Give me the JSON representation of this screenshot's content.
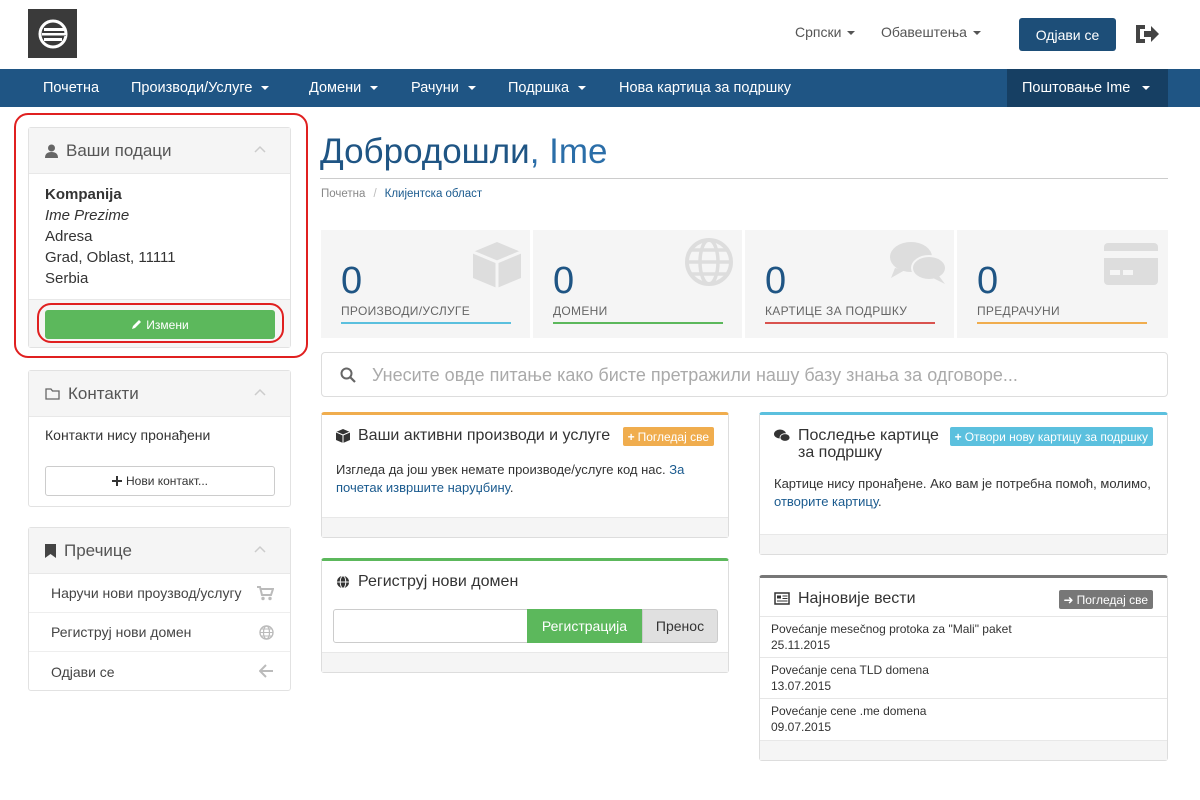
{
  "header": {
    "language": "Српски",
    "notifications": "Обавештења",
    "logout": "Одјави се"
  },
  "nav": {
    "items": [
      {
        "label": "Почетна"
      },
      {
        "label": "Производи/Услуге"
      },
      {
        "label": "Домени"
      },
      {
        "label": "Рачуни"
      },
      {
        "label": "Подршка"
      },
      {
        "label": "Нова картица за подршку"
      }
    ],
    "account": "Поштовање Ime"
  },
  "sidebar": {
    "your_info": {
      "title": "Ваши подаци",
      "company": "Kompanija",
      "name": "Ime Prezime",
      "address": "Adresa",
      "city": "Grad, Oblast, 11111",
      "country": "Serbia",
      "edit_button": "Измени"
    },
    "contacts": {
      "title": "Контакти",
      "empty": "Контакти нису пронађени",
      "new_button": "Нови контакт..."
    },
    "shortcuts": {
      "title": "Пречице",
      "items": [
        {
          "label": "Наручи нови проузвод/услугу",
          "icon": "cart-icon"
        },
        {
          "label": "Регистpуј нови домен",
          "icon": "globe-icon"
        },
        {
          "label": "Одјави се",
          "icon": "arrow-left-icon"
        }
      ]
    }
  },
  "main": {
    "welcome": "Добродошли",
    "welcome_name": ", Ime",
    "breadcrumb": [
      "Почетна",
      "Клијентска област"
    ],
    "tiles": [
      {
        "value": "0",
        "label": "ПРОИЗВОДИ/УСЛУГЕ",
        "color": "#5bc0de",
        "icon": "cube-icon"
      },
      {
        "value": "0",
        "label": "ДОМЕНИ",
        "color": "#5cb85c",
        "icon": "globe-icon"
      },
      {
        "value": "0",
        "label": "КАРТИЦЕ ЗА ПОДРШКУ",
        "color": "#d9534f",
        "icon": "comments-icon"
      },
      {
        "value": "0",
        "label": "ПРЕДРАЧУНИ",
        "color": "#f0ad4e",
        "icon": "credit-card-icon"
      }
    ],
    "search_placeholder": "Унесите овде питање како бисте претражили нашу базу знања за одговоре...",
    "active_products": {
      "title": "Ваши активни производи и услуге",
      "button": "Погледај све",
      "text_before": "Изгледа да још увек немате производе/услуге код нас.",
      "link": "За почетак извршите наруџбину",
      "text_after": "."
    },
    "register_domain": {
      "title": "Региструј нови домен",
      "register_button": "Регистрација",
      "transfer_button": "Пренос"
    },
    "recent_tickets": {
      "title": "Последње картице за подршку",
      "button": "Отвори нову картицу за подршку",
      "text_before": "Картице нису пронађене. Ако вам је потребна помоћ, молимо,",
      "link": "отворите картицу",
      "text_after": "."
    },
    "news": {
      "title": "Најновије вести",
      "button": "Погледај све",
      "items": [
        {
          "title": "Povećanje mesečnog protoka za \"Mali\" paket",
          "date": "25.11.2015"
        },
        {
          "title": "Povećanje cena TLD domena",
          "date": "13.07.2015"
        },
        {
          "title": "Povećanje cene .me domena",
          "date": "09.07.2015"
        }
      ]
    }
  },
  "colors": {
    "brand_dark": "#1f5584",
    "green": "#5cb85c",
    "highlight_ring": "#e02020"
  }
}
